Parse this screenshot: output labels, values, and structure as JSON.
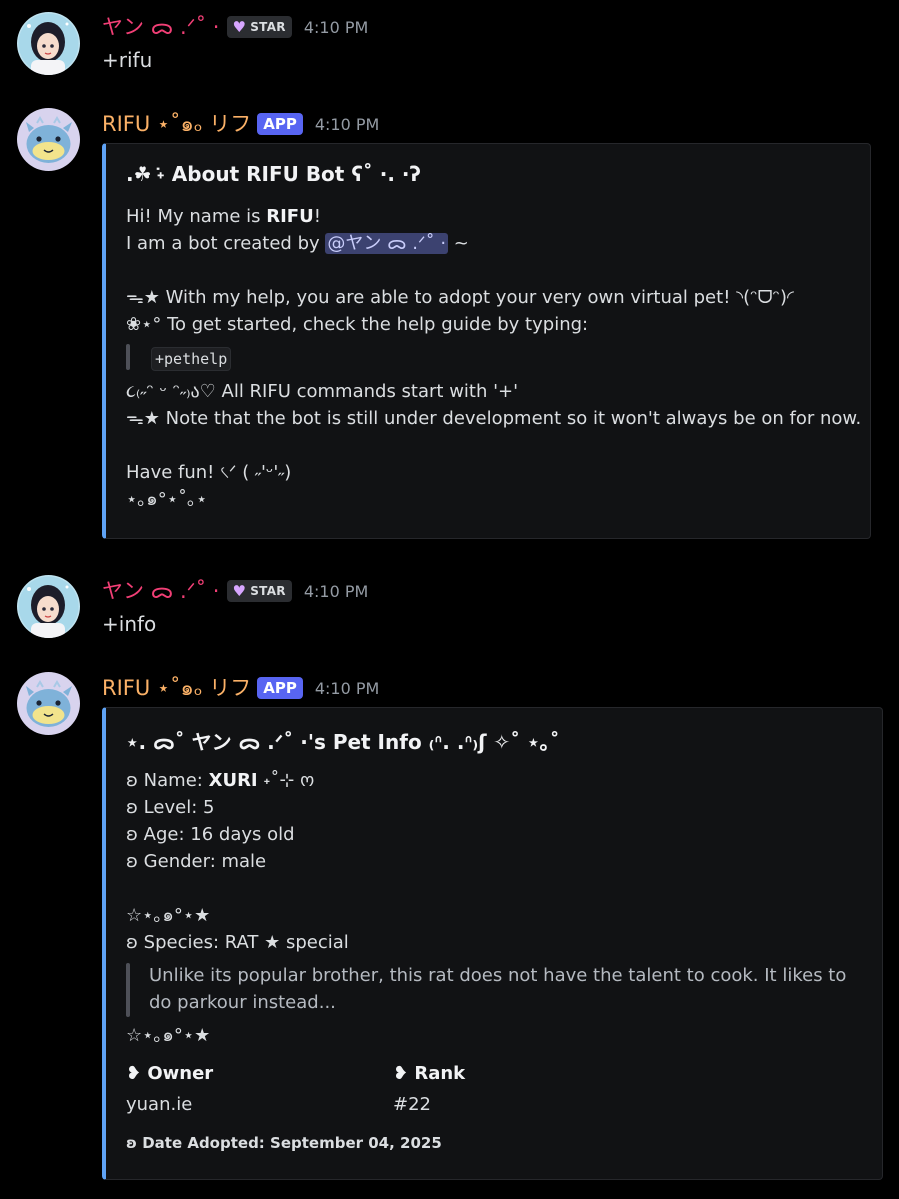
{
  "messages": [
    {
      "author": "ヤン ᯅ .ᐟ˚ ·",
      "badge": "STAR",
      "time": "4:10 PM",
      "text": "+rifu"
    },
    {
      "author": "RIFU ⋆˚๑ₒ リフ",
      "badge": "APP",
      "time": "4:10 PM",
      "embed": {
        "title": ".☘︎ ݁˖ About RIFU Bot ʕ˚ ·. ·ʔ",
        "line1_prefix": "Hi! My name is ",
        "line1_bold": "RIFU",
        "line1_suffix": "!",
        "line2_prefix": "I am a bot created by ",
        "line2_mention": "@ヤン ᯅ .ᐟ˚ ·",
        "line2_suffix": " ~",
        "line3": "ᯓ★ With my help, you are able to adopt your very own virtual pet! ◝(ᵔᗜᵔ)◜",
        "line4": "❀⋆° To get started, check the help guide by typing:",
        "code": "+pethelp",
        "line5": "૮₍˶ᵔ ᵕ ᵔ˶₎ა♡ All RIFU commands start with '+'",
        "line6": "ᯓ★ Note that the bot is still under development so it won't always be on for now.",
        "line7": "Have fun! ৻ᐟ ( ˶'ᵕ'˶)",
        "line8": "⋆｡๑°⋆˚｡⋆"
      }
    },
    {
      "author": "ヤン ᯅ .ᐟ˚ ·",
      "badge": "STAR",
      "time": "4:10 PM",
      "text": "+info"
    },
    {
      "author": "RIFU ⋆˚๑ₒ リフ",
      "badge": "APP",
      "time": "4:10 PM",
      "embed": {
        "title": "⋆. ᯅ˚ ヤン ᯅ .ᐟ˚ ·'s Pet Info ₍ᐢ. .ᐢ₎ʃ ✧˚ ⋆｡˚",
        "name_label": "ʚ Name: ",
        "name_value": "XURI",
        "name_suffix": " ˖˚⊹ ო",
        "level": "ʚ Level: 5",
        "age": "ʚ Age: 16 days old",
        "gender": "ʚ Gender: male",
        "divider1": "☆⋆｡๑°⋆★",
        "species": "ʚ Species: RAT ★ special",
        "quote": "Unlike its popular brother, this rat does not have the talent to cook. It likes to do parkour instead...",
        "divider2": "☆⋆｡๑°⋆★",
        "fields": [
          {
            "name": "❥ Owner",
            "value": "yuan.ie"
          },
          {
            "name": "❥ Rank",
            "value": "#22"
          }
        ],
        "footer": "ʚ Date Adopted: September 04, 2025"
      }
    }
  ],
  "colors": {
    "background": "#000000",
    "user_name": "#f23f76",
    "bot_name": "#fbb167",
    "app_badge": "#5865f2",
    "embed_bg": "#111214",
    "embed_accent": "#5fa3f5"
  }
}
